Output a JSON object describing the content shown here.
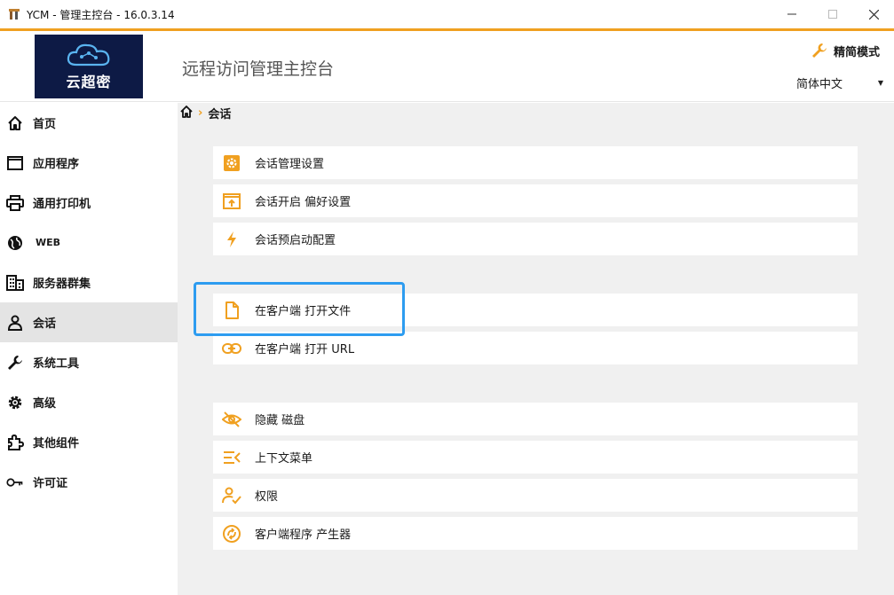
{
  "window": {
    "title": "YCM - 管理主控台 - 16.0.3.14"
  },
  "header": {
    "logo_text": "云超密",
    "console_title": "远程访问管理主控台",
    "mode_label": "精简模式",
    "language_value": "简体中文"
  },
  "sidebar": {
    "items": [
      {
        "label": "首页"
      },
      {
        "label": "应用程序"
      },
      {
        "label": "通用打印机"
      },
      {
        "label": "WEB"
      },
      {
        "label": "服务器群集"
      },
      {
        "label": "会话"
      },
      {
        "label": "系统工具"
      },
      {
        "label": "高级"
      },
      {
        "label": "其他组件"
      },
      {
        "label": "许可证"
      }
    ],
    "active_index": 5
  },
  "breadcrumb": {
    "current": "会话"
  },
  "groups": [
    {
      "rows": [
        {
          "label": "会话管理设置",
          "icon": "gear-icon"
        },
        {
          "label": "会话开启 偏好设置",
          "icon": "window-upload-icon"
        },
        {
          "label": "会话预启动配置",
          "icon": "lightning-icon"
        }
      ]
    },
    {
      "rows": [
        {
          "label": "在客户端 打开文件",
          "icon": "file-icon"
        },
        {
          "label": "在客户端 打开 URL",
          "icon": "link-icon"
        }
      ]
    },
    {
      "rows": [
        {
          "label": "隐藏 磁盘",
          "icon": "eye-off-icon"
        },
        {
          "label": "上下文菜单",
          "icon": "menu-icon"
        },
        {
          "label": "权限",
          "icon": "user-check-icon"
        },
        {
          "label": "客户端程序 产生器",
          "icon": "sync-icon"
        }
      ]
    }
  ],
  "colors": {
    "accent": "#f0a020",
    "highlight": "#2d9cf0",
    "logo_bg": "#0d1a45"
  }
}
